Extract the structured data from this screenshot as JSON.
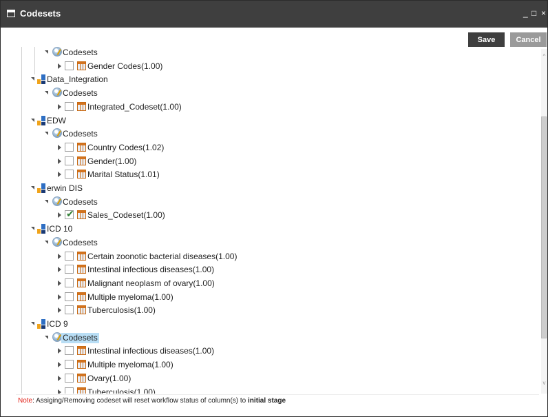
{
  "window": {
    "title": "Codesets",
    "minimize": "_",
    "maximize": "□",
    "close": "×"
  },
  "toolbar": {
    "save_label": "Save",
    "cancel_label": "Cancel"
  },
  "tree_rows": [
    {
      "level": 1,
      "type": "codesets",
      "label": "Codesets",
      "toggle": "exp"
    },
    {
      "level": 2,
      "type": "table",
      "label": "Gender Codes(1.00)",
      "toggle": "col",
      "checked": false
    },
    {
      "level": 0,
      "type": "model",
      "label": "Data_Integration",
      "toggle": "exp"
    },
    {
      "level": 1,
      "type": "codesets",
      "label": "Codesets",
      "toggle": "exp"
    },
    {
      "level": 2,
      "type": "table",
      "label": "Integrated_Codeset(1.00)",
      "toggle": "col",
      "checked": false
    },
    {
      "level": 0,
      "type": "model",
      "label": "EDW",
      "toggle": "exp"
    },
    {
      "level": 1,
      "type": "codesets",
      "label": "Codesets",
      "toggle": "exp"
    },
    {
      "level": 2,
      "type": "table",
      "label": "Country Codes(1.02)",
      "toggle": "col",
      "checked": false
    },
    {
      "level": 2,
      "type": "table",
      "label": "Gender(1.00)",
      "toggle": "col",
      "checked": false
    },
    {
      "level": 2,
      "type": "table",
      "label": "Marital Status(1.01)",
      "toggle": "col",
      "checked": false
    },
    {
      "level": 0,
      "type": "model",
      "label": "erwin DIS",
      "toggle": "exp"
    },
    {
      "level": 1,
      "type": "codesets",
      "label": "Codesets",
      "toggle": "exp"
    },
    {
      "level": 2,
      "type": "table",
      "label": "Sales_Codeset(1.00)",
      "toggle": "col",
      "checked": true
    },
    {
      "level": 0,
      "type": "model",
      "label": "ICD 10",
      "toggle": "exp"
    },
    {
      "level": 1,
      "type": "codesets",
      "label": "Codesets",
      "toggle": "exp"
    },
    {
      "level": 2,
      "type": "table",
      "label": "Certain zoonotic bacterial diseases(1.00)",
      "toggle": "col",
      "checked": false
    },
    {
      "level": 2,
      "type": "table",
      "label": "Intestinal infectious diseases(1.00)",
      "toggle": "col",
      "checked": false
    },
    {
      "level": 2,
      "type": "table",
      "label": "Malignant neoplasm of ovary(1.00)",
      "toggle": "col",
      "checked": false
    },
    {
      "level": 2,
      "type": "table",
      "label": "Multiple myeloma(1.00)",
      "toggle": "col",
      "checked": false
    },
    {
      "level": 2,
      "type": "table",
      "label": "Tuberculosis(1.00)",
      "toggle": "col",
      "checked": false
    },
    {
      "level": 0,
      "type": "model",
      "label": "ICD 9",
      "toggle": "exp"
    },
    {
      "level": 1,
      "type": "codesets",
      "label": "Codesets",
      "toggle": "exp",
      "selected": true
    },
    {
      "level": 2,
      "type": "table",
      "label": "Intestinal infectious diseases(1.00)",
      "toggle": "col",
      "checked": false
    },
    {
      "level": 2,
      "type": "table",
      "label": "Multiple myeloma(1.00)",
      "toggle": "col",
      "checked": false
    },
    {
      "level": 2,
      "type": "table",
      "label": "Ovary(1.00)",
      "toggle": "col",
      "checked": false
    },
    {
      "level": 2,
      "type": "table",
      "label": "Tuberculosis(1.00)",
      "toggle": "col",
      "checked": false
    }
  ],
  "note": {
    "prefix": "Note",
    "text": ": Assiging/Removing codeset will reset workflow status of column(s) to ",
    "emphasis": "initial stage"
  },
  "colors": {
    "titlebar": "#3f3f3f",
    "save": "#3f3f3f",
    "cancel": "#9a9a9a",
    "selection": "#b9def5",
    "note_prefix": "#e2231a"
  }
}
